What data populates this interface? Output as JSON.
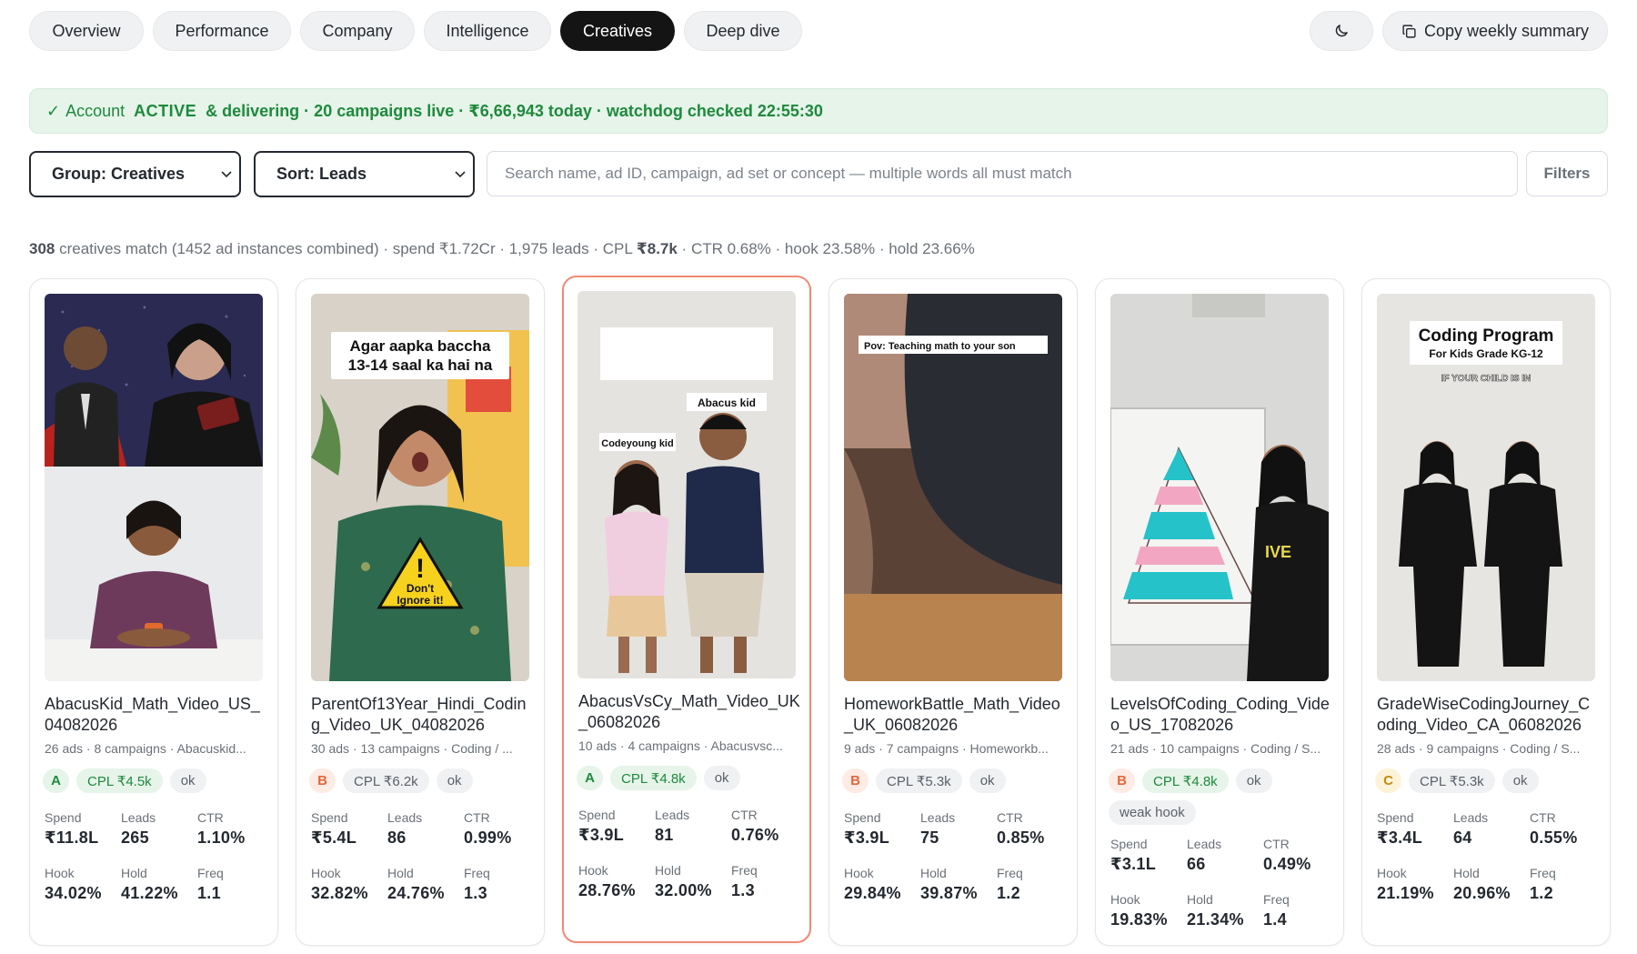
{
  "nav": {
    "tabs": [
      {
        "label": "Overview",
        "active": false
      },
      {
        "label": "Performance",
        "active": false
      },
      {
        "label": "Company",
        "active": false
      },
      {
        "label": "Intelligence",
        "active": false
      },
      {
        "label": "Creatives",
        "active": true
      },
      {
        "label": "Deep dive",
        "active": false
      }
    ],
    "theme_icon": "moon-icon",
    "copy_icon": "copy-icon",
    "copy_label": "Copy weekly summary"
  },
  "banner": {
    "check": "✓",
    "prefix": "Account",
    "status": "ACTIVE",
    "rest": "& delivering · 20 campaigns live · ₹6,66,943 today · watchdog checked 22:55:30",
    "color": "#1e8a3c"
  },
  "controls": {
    "group_value": "Group: Creatives",
    "sort_value": "Sort: Leads",
    "search_placeholder": "Search name, ad ID, campaign, ad set or concept — multiple words all must match",
    "filters_label": "Filters"
  },
  "summary": {
    "count": "308",
    "count_text": "creatives match (1452 ad instances combined) · spend ₹1.72Cr · 1,975 leads · CPL",
    "cpl": "₹8.7k",
    "tail": "CTR 0.68% · hook 23.58% · hold 23.66%"
  },
  "metric_labels": {
    "spend": "Spend",
    "leads": "Leads",
    "ctr": "CTR",
    "hook": "Hook",
    "hold": "Hold",
    "freq": "Freq"
  },
  "cards": [
    {
      "name": "AbacusKid_Math_Video_US_04082026",
      "sub": "26 ads · 8 campaigns · Abacuskid...",
      "grade": "A",
      "cpl": "CPL ₹4.5k",
      "cpl_tone": "good",
      "status": "ok",
      "extra": null,
      "spend": "₹11.8L",
      "leads": "265",
      "ctr": "1.10%",
      "hook": "34.02%",
      "hold": "41.22%",
      "freq": "1.1",
      "selected": false,
      "overlay": []
    },
    {
      "name": "ParentOf13Year_Hindi_Coding_Video_UK_04082026",
      "sub": "30 ads · 13 campaigns · Coding / ...",
      "grade": "B",
      "cpl": "CPL ₹6.2k",
      "cpl_tone": "mid",
      "status": "ok",
      "extra": null,
      "spend": "₹5.4L",
      "leads": "86",
      "ctr": "0.99%",
      "hook": "32.82%",
      "hold": "24.76%",
      "freq": "1.3",
      "selected": false,
      "overlay": [
        "Agar aapka baccha",
        "13-14 saal ka hai na",
        "Don't",
        "Ignore it!"
      ]
    },
    {
      "name": "AbacusVsCy_Math_Video_UK_06082026",
      "sub": "10 ads · 4 campaigns · Abacusvsc...",
      "grade": "A",
      "cpl": "CPL ₹4.8k",
      "cpl_tone": "good",
      "status": "ok",
      "extra": null,
      "spend": "₹3.9L",
      "leads": "81",
      "ctr": "0.76%",
      "hook": "28.76%",
      "hold": "32.00%",
      "freq": "1.3",
      "selected": true,
      "overlay": [
        "Abacus kid",
        "Codeyoung kid"
      ]
    },
    {
      "name": "HomeworkBattle_Math_Video_UK_06082026",
      "sub": "9 ads · 7 campaigns · Homeworkb...",
      "grade": "B",
      "cpl": "CPL ₹5.3k",
      "cpl_tone": "mid",
      "status": "ok",
      "extra": null,
      "spend": "₹3.9L",
      "leads": "75",
      "ctr": "0.85%",
      "hook": "29.84%",
      "hold": "39.87%",
      "freq": "1.2",
      "selected": false,
      "overlay": [
        "Pov: Teaching math to your son"
      ]
    },
    {
      "name": "LevelsOfCoding_Coding_Video_US_17082026",
      "sub": "21 ads · 10 campaigns · Coding / S...",
      "grade": "B",
      "cpl": "CPL ₹4.8k",
      "cpl_tone": "good",
      "status": "ok",
      "extra": "weak hook",
      "spend": "₹3.1L",
      "leads": "66",
      "ctr": "0.49%",
      "hook": "19.83%",
      "hold": "21.34%",
      "freq": "1.4",
      "selected": false,
      "overlay": []
    },
    {
      "name": "GradeWiseCodingJourney_Coding_Video_CA_06082026",
      "sub": "28 ads · 9 campaigns · Coding / S...",
      "grade": "C",
      "cpl": "CPL ₹5.3k",
      "cpl_tone": "mid",
      "status": "ok",
      "extra": null,
      "spend": "₹3.4L",
      "leads": "64",
      "ctr": "0.55%",
      "hook": "21.19%",
      "hold": "20.96%",
      "freq": "1.2",
      "selected": false,
      "overlay": [
        "Coding Program",
        "For Kids Grade KG-12",
        "IF YOUR CHILD IS IN"
      ]
    }
  ]
}
